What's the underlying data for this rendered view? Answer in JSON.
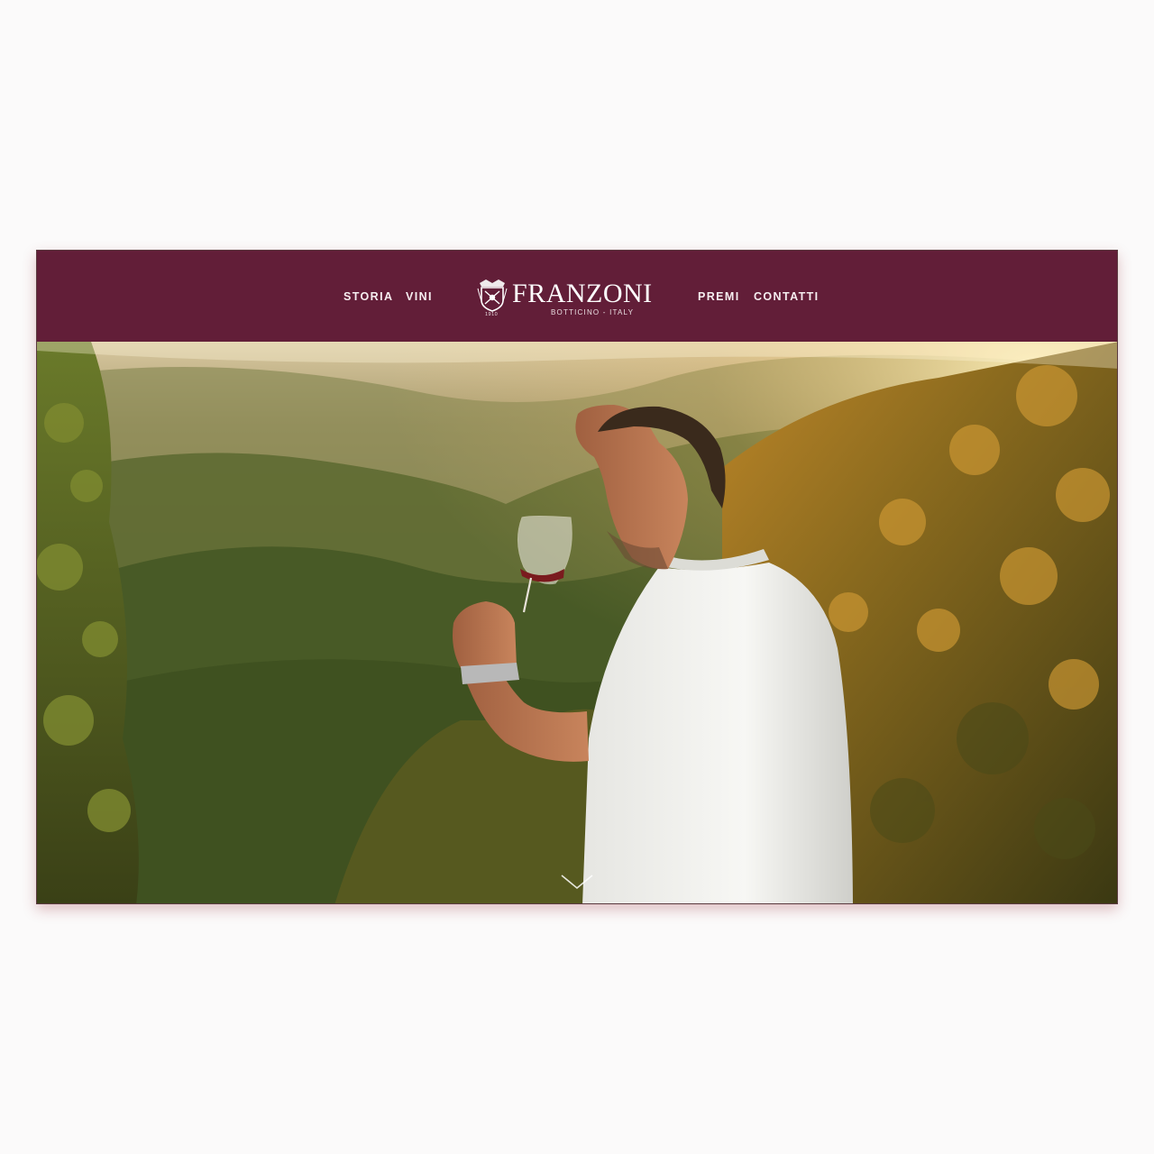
{
  "nav": {
    "left": [
      {
        "label": "STORIA"
      },
      {
        "label": "VINI"
      }
    ],
    "right": [
      {
        "label": "PREMI"
      },
      {
        "label": "CONTATTI"
      }
    ]
  },
  "logo": {
    "name": "FRANZONI",
    "subtitle": "BOTTICINO - ITALY",
    "year": "1910",
    "icon": "crest-icon"
  },
  "hero": {
    "image": "man-tasting-red-wine-in-vineyard-photo",
    "scroll_icon": "chevron-down-icon"
  },
  "colors": {
    "navbar": "#621e38",
    "nav_text": "#f6eef0",
    "page_background": "#fbfafa"
  }
}
